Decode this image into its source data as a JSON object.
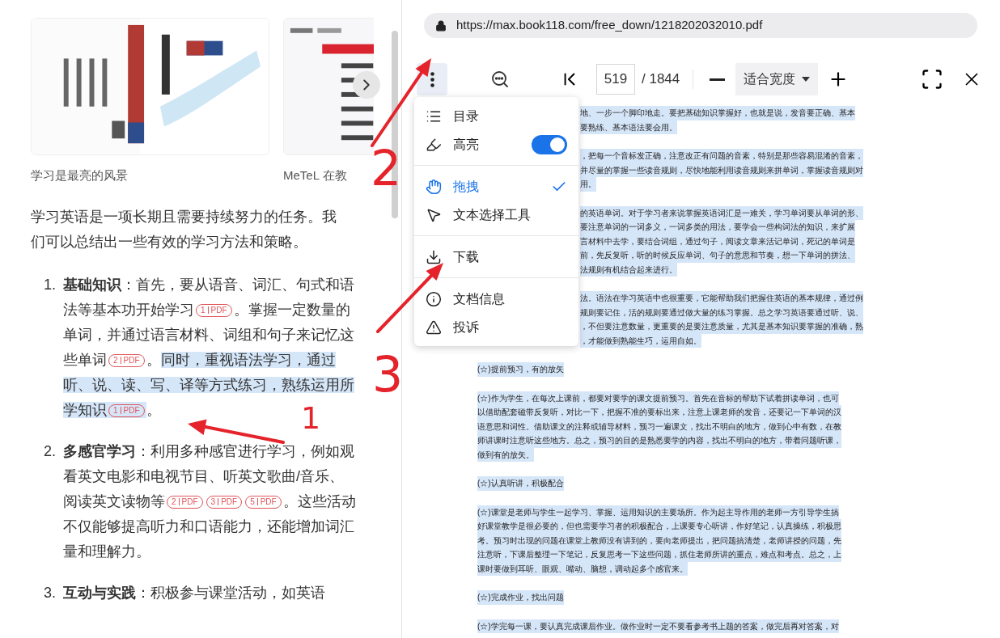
{
  "carousel": {
    "cards": [
      {
        "kind": "picture",
        "caption": "学习是最亮的风景"
      },
      {
        "kind": "picture",
        "caption": "MeTeL 在教"
      }
    ]
  },
  "intro": "学习英语是一项长期且需要持续努力的任务。我们可以总结出一些有效的学习方法和策略。",
  "list": [
    {
      "number": "1.",
      "title": "基础知识",
      "segments": [
        {
          "kind": "text",
          "text": "：首先，要从语音、词汇、句式和语法等基本功开始学习"
        },
        {
          "kind": "cite",
          "number": "1",
          "label": "PDF",
          "highlighted": false
        },
        {
          "kind": "text",
          "text": "。掌握一定数量的单词，并通过语言材料、词组和句子来记忆这些单词"
        },
        {
          "kind": "cite",
          "number": "2",
          "label": "PDF",
          "highlighted": false
        },
        {
          "kind": "text",
          "text": "。"
        },
        {
          "kind": "text",
          "text": "同时，重视语法学习，通过听、说、读、写、译等方式练习，熟练运用所学知识",
          "highlighted": true
        },
        {
          "kind": "cite",
          "number": "1",
          "label": "PDF",
          "highlighted": true
        },
        {
          "kind": "text",
          "text": "。"
        }
      ]
    },
    {
      "number": "2.",
      "title": "多感官学习",
      "segments": [
        {
          "kind": "text",
          "text": "：利用多种感官进行学习，例如观看英文电影和电视节目、听英文歌曲/音乐、阅读英文读物等"
        },
        {
          "kind": "cite",
          "number": "2",
          "label": "PDF",
          "highlighted": false
        },
        {
          "kind": "cite",
          "number": "3",
          "label": "PDF",
          "highlighted": false
        },
        {
          "kind": "cite",
          "number": "5",
          "label": "PDF",
          "highlighted": false
        },
        {
          "kind": "text",
          "text": "。这些活动不仅能够提高听力和口语能力，还能增加词汇量和理解力。"
        }
      ]
    },
    {
      "number": "3.",
      "title": "互动与实践",
      "segments": [
        {
          "kind": "text",
          "text": "：积极参与课堂活动，如英语"
        }
      ]
    }
  ],
  "address_bar": {
    "url": "https://max.book118.com/free_down/1218202032010.pdf"
  },
  "toolbar": {
    "menu_selected": true,
    "page": "519",
    "total": "/ 1844",
    "zoom": "适合宽度"
  },
  "menu": {
    "groups": [
      [
        {
          "kind": "item",
          "label": "目录"
        },
        {
          "kind": "toggle",
          "label": "高亮",
          "on": true
        }
      ],
      [
        {
          "kind": "choice",
          "label": "拖拽",
          "selected": true
        },
        {
          "kind": "choice",
          "label": "文本选择工具",
          "selected": false
        }
      ],
      [
        {
          "kind": "item",
          "label": "下载"
        }
      ],
      [
        {
          "kind": "item",
          "label": "文档信息"
        },
        {
          "kind": "item",
          "label": "投诉"
        }
      ]
    ]
  },
  "pdf": {
    "blocks": [
      {
        "kind": "covered",
        "highlighted": true,
        "lines": [
          "地、一步一个脚印地走。要把基础知识掌握好，也就是说，发音要正确、基本",
          "要熟练、基本语法要会用。"
        ]
      },
      {
        "kind": "covered",
        "highlighted": true,
        "lines": [
          "，把每一个音标发正确，注意改正有问题的音素，特别是那些容易混淆的音素，",
          "并尽量的掌握一些读音规则，尽快地能利用读音规则来拼单词，掌握读音规则对",
          "用。"
        ]
      },
      {
        "kind": "covered",
        "highlighted": true,
        "lines": [
          "的英语单词。对于学习者来说掌握英语词汇是一难关，学习单词要从单词的形、",
          "要注意单词的一词多义，一词多类的用法，要学会一些构词法的知识，来扩展",
          "言材料中去学，要结合词组，通过句子，阅读文章来活记单词，死记的单词是",
          "前，先反复听，听的时候反应单词、句子的意思和节奏，想一下单词的拼法、",
          "法规则有机结合起来进行。"
        ]
      },
      {
        "kind": "covered",
        "highlighted": true,
        "lines": [
          "法。语法在学习英语中也很重要，它能帮助我们把握住英语的基本规律，通过例",
          "规则要记住，活的规则要通过做大量的练习掌握。总之学习英语要通过听、说、",
          "，不但要注意数量，更重要的是要注意质量，尤其是基本知识要掌握的准确，熟",
          "，才能做到熟能生巧，运用自如。"
        ]
      },
      {
        "kind": "full",
        "highlighted": true,
        "lines": [
          "(☆)提前预习，有的放矢"
        ]
      },
      {
        "kind": "full",
        "highlighted": true,
        "lines": [
          "(☆)作为学生，在每次上课前，都要对要学的课文提前预习。首先在音标的帮助下试着拼读单词，也可",
          "以借助配套磁带反复听，对比一下，把握不准的要标出来，注意上课老师的发音，还要记一下单词的汉",
          "语意思和词性。借助课文的注释或辅导材料，预习一遍课文，找出不明白的地方，做到心中有数，在教",
          "师讲课时注意听这些地方。总之，预习的目的是熟悉要学的内容，找出不明白的地方，带着问题听课，",
          "做到有的放矢。"
        ]
      },
      {
        "kind": "full",
        "highlighted": true,
        "lines": [
          "(☆)认真听讲，积极配合"
        ]
      },
      {
        "kind": "full",
        "highlighted": true,
        "lines": [
          "(☆)课堂是老师与学生一起学习、掌握、运用知识的主要场所。作为起主导作用的老师一方引导学生搞",
          "好课堂教学是很必要的，但也需要学习者的积极配合，上课要专心听讲，作好笔记，认真操练，积极思",
          "考。预习时出现的问题在课堂上教师没有讲到的，要向老师提出，把问题搞清楚，老师讲授的问题，先",
          "注意听，下课后整理一下笔记，反复思考一下这些问题，抓住老师所讲的重点，难点和考点。总之，上",
          "课时要做到耳听、眼观、嘴动、脑想，调动起多个感官来。"
        ]
      },
      {
        "kind": "full",
        "highlighted": true,
        "lines": [
          "(☆)完成作业，找出问题"
        ]
      },
      {
        "kind": "full",
        "highlighted": true,
        "lines": [
          "(☆)学完每一课，要认真完成课后作业。做作业时一定不要看参考书上题的答案，做完后再对答案，对"
        ]
      }
    ]
  },
  "annotations": [
    {
      "kind": "number",
      "text": "2"
    },
    {
      "kind": "number",
      "text": "3"
    },
    {
      "kind": "number",
      "text": "1"
    }
  ]
}
